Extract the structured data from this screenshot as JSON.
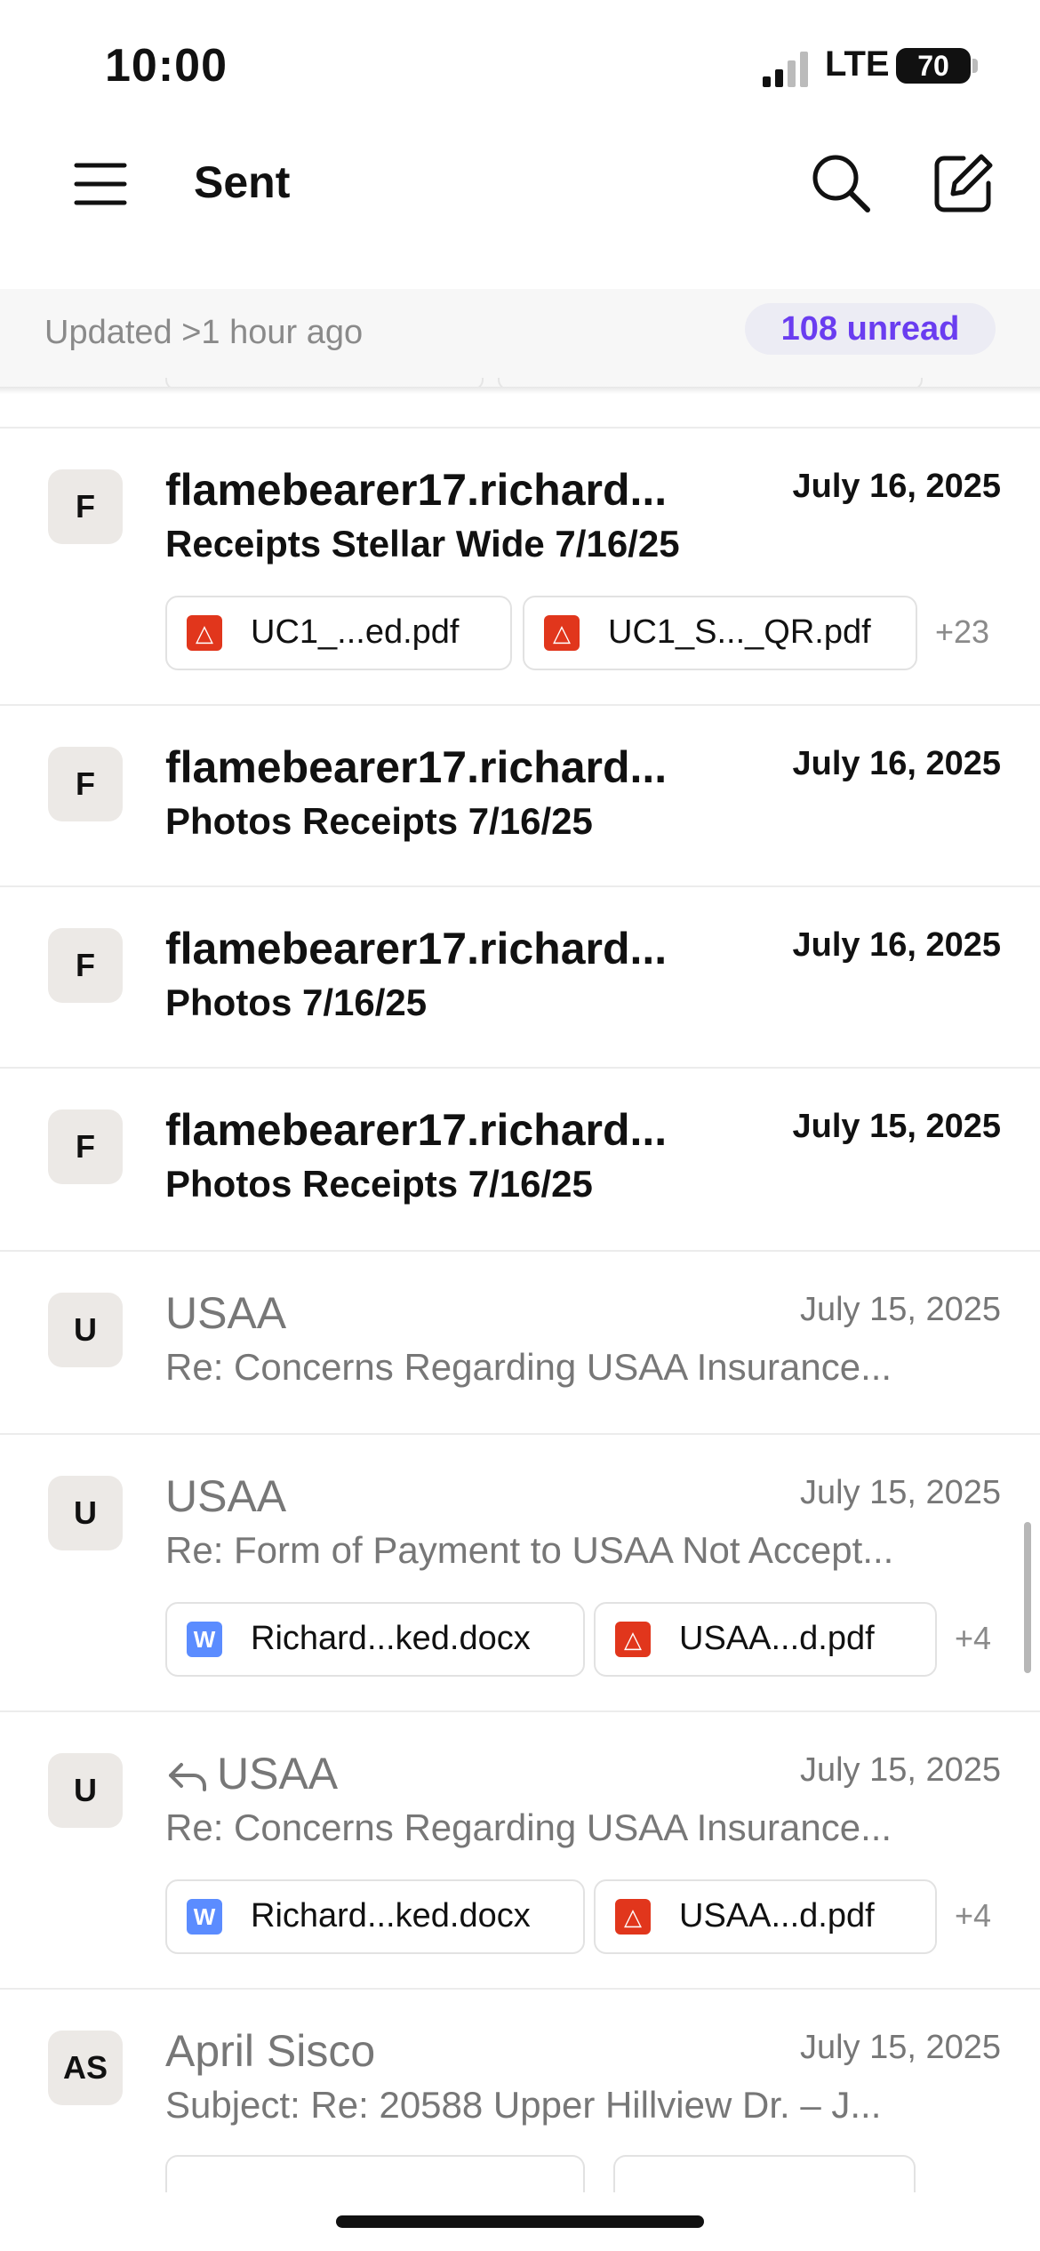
{
  "status_bar": {
    "time": "10:00",
    "network": "LTE",
    "battery": "70"
  },
  "header": {
    "title": "Sent",
    "menu_icon": "hamburger-menu-icon",
    "search_icon": "search-icon",
    "compose_icon": "compose-icon"
  },
  "sync": {
    "updated": "Updated >1 hour ago",
    "unread": "108 unread",
    "accent_color": "#6a3df0"
  },
  "emails": [
    {
      "avatar": "F",
      "sender": "flamebearer17.richard...",
      "date": "July 16, 2025",
      "subject": "Receipts Stellar Wide 7/16/25",
      "attachments": [
        {
          "type": "pdf",
          "name": "UC1_...ed.pdf"
        },
        {
          "type": "pdf",
          "name": "UC1_S..._QR.pdf"
        }
      ],
      "more": "+23"
    },
    {
      "avatar": "F",
      "sender": "flamebearer17.richard...",
      "date": "July 16, 2025",
      "subject": "Photos Receipts 7/16/25"
    },
    {
      "avatar": "F",
      "sender": "flamebearer17.richard...",
      "date": "July 16, 2025",
      "subject": "Photos 7/16/25"
    },
    {
      "avatar": "F",
      "sender": "flamebearer17.richard...",
      "date": "July 15, 2025",
      "subject": "Photos Receipts 7/16/25"
    },
    {
      "avatar": "U",
      "sender": "USAA",
      "date": "July 15, 2025",
      "subject": "Re: Concerns Regarding USAA Insurance..."
    },
    {
      "avatar": "U",
      "sender": "USAA",
      "date": "July 15, 2025",
      "subject": "Re: Form of Payment to USAA Not Accept...",
      "attachments": [
        {
          "type": "doc",
          "name": "Richard...ked.docx"
        },
        {
          "type": "pdf",
          "name": "USAA...d.pdf"
        }
      ],
      "more": "+4"
    },
    {
      "avatar": "U",
      "sender": "USAA",
      "date": "July 15, 2025",
      "subject": "Re: Concerns Regarding USAA Insurance...",
      "attachments": [
        {
          "type": "doc",
          "name": "Richard...ked.docx"
        },
        {
          "type": "pdf",
          "name": "USAA...d.pdf"
        }
      ],
      "more": "+4",
      "replied": true
    },
    {
      "avatar": "AS",
      "sender": "April Sisco",
      "date": "July 15, 2025",
      "subject": "Subject: Re: 20588 Upper Hillview Dr. – J..."
    }
  ],
  "attachment_icon_letters": {
    "doc": "W"
  }
}
